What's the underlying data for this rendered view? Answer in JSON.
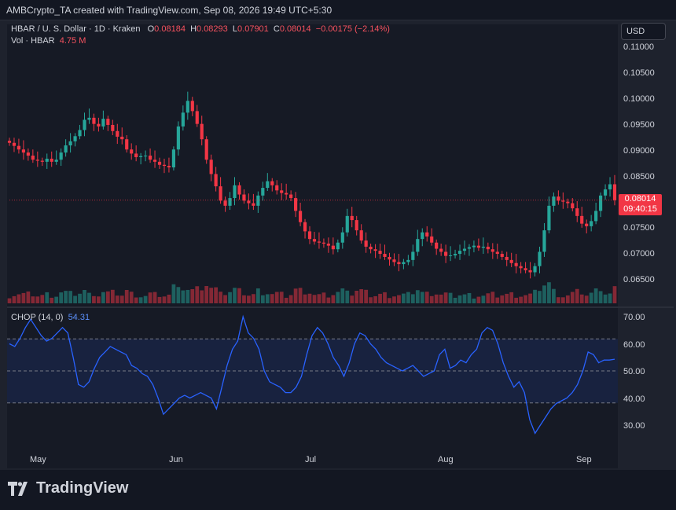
{
  "header": {
    "creator": "AMBCrypto_TA created with TradingView.com, Sep 08, 2026 19:49 UTC+5:30"
  },
  "legend": {
    "symbol": "HBAR / U. S. Dollar · 1D · Kraken",
    "o_label": "O",
    "o": "0.08184",
    "h_label": "H",
    "h": "0.08293",
    "l_label": "L",
    "l": "0.07901",
    "c_label": "C",
    "c": "0.08014",
    "change": "−0.00175 (−2.14%)",
    "vol_label": "Vol · HBAR",
    "vol": "4.75 M"
  },
  "currency_button": "USD",
  "price_axis": [
    "0.11000",
    "0.10500",
    "0.10000",
    "0.09500",
    "0.09000",
    "0.08500",
    "0.07500",
    "0.07000",
    "0.06500"
  ],
  "price_tag": {
    "price": "0.08014",
    "countdown": "09:40:15"
  },
  "chop_legend": {
    "label": "CHOP (14, 0)",
    "value": "54.31"
  },
  "chop_axis": [
    "70.00",
    "60.00",
    "50.00",
    "40.00",
    "30.00"
  ],
  "date_axis": [
    "May",
    "Jun",
    "Jul",
    "Aug",
    "Sep"
  ],
  "footer": {
    "brand": "TradingView"
  },
  "colors": {
    "up": "#26a69a",
    "down": "#f23645",
    "chop": "#2962ff",
    "background": "#131722"
  },
  "chart_data": [
    {
      "type": "candlestick",
      "title": "HBAR / U. S. Dollar · 1D · Kraken",
      "ylim": [
        0.061,
        0.111
      ],
      "x_labels": [
        "May",
        "Jun",
        "Jul",
        "Aug",
        "Sep"
      ],
      "close": [
        0.0913,
        0.0907,
        0.09,
        0.0894,
        0.0888,
        0.088,
        0.0878,
        0.0876,
        0.0882,
        0.0876,
        0.088,
        0.0894,
        0.0908,
        0.0916,
        0.0926,
        0.0938,
        0.0958,
        0.0962,
        0.095,
        0.0945,
        0.096,
        0.0948,
        0.0936,
        0.0925,
        0.092,
        0.09,
        0.0892,
        0.0885,
        0.0887,
        0.0888,
        0.088,
        0.0876,
        0.087,
        0.0868,
        0.0865,
        0.09,
        0.0945,
        0.0972,
        0.0995,
        0.0975,
        0.095,
        0.092,
        0.088,
        0.0852,
        0.0828,
        0.08,
        0.079,
        0.0805,
        0.083,
        0.0812,
        0.08,
        0.0795,
        0.079,
        0.081,
        0.0825,
        0.0838,
        0.083,
        0.082,
        0.0815,
        0.0812,
        0.0805,
        0.078,
        0.0758,
        0.074,
        0.0725,
        0.072,
        0.0718,
        0.0716,
        0.0712,
        0.0705,
        0.0718,
        0.0738,
        0.077,
        0.0762,
        0.0742,
        0.0722,
        0.071,
        0.0705,
        0.0702,
        0.0696,
        0.069,
        0.0685,
        0.068,
        0.0676,
        0.068,
        0.0684,
        0.07,
        0.0725,
        0.0738,
        0.073,
        0.0718,
        0.0706,
        0.07,
        0.0692,
        0.0693,
        0.0696,
        0.0702,
        0.0706,
        0.0709,
        0.0712,
        0.0708,
        0.071,
        0.0705,
        0.07,
        0.0696,
        0.069,
        0.0684,
        0.0678,
        0.0672,
        0.0668,
        0.0664,
        0.066,
        0.0672,
        0.07,
        0.0742,
        0.079,
        0.0808,
        0.08,
        0.0798,
        0.0795,
        0.0785,
        0.077,
        0.0755,
        0.075,
        0.076,
        0.078,
        0.081,
        0.0822,
        0.0832,
        0.0801
      ],
      "volume_peak_labels": [
        "4.75 M"
      ]
    },
    {
      "type": "line",
      "title": "CHOP (14, 0)",
      "ylim": [
        20,
        75
      ],
      "bands": [
        38.2,
        50,
        61.8
      ],
      "values": [
        60,
        59,
        62,
        66,
        69,
        66,
        63,
        61,
        62,
        64,
        66,
        64,
        55,
        45,
        44,
        46,
        51,
        55,
        57,
        59,
        58,
        57,
        56,
        52,
        51,
        49,
        48,
        45,
        40,
        34,
        36,
        38,
        40,
        41,
        40,
        41,
        42,
        41,
        40,
        36,
        44,
        52,
        58,
        61,
        70,
        64,
        62,
        58,
        50,
        46,
        45,
        44,
        42,
        42,
        44,
        48,
        56,
        63,
        66,
        64,
        60,
        55,
        52,
        48,
        53,
        60,
        64,
        63,
        60,
        58,
        55,
        53,
        52,
        51,
        50,
        51,
        52,
        50,
        48,
        49,
        50,
        56,
        58,
        51,
        52,
        54,
        53,
        56,
        58,
        64,
        66,
        65,
        60,
        53,
        48,
        44,
        46,
        42,
        32,
        27,
        30,
        33,
        36,
        38,
        39,
        40,
        42,
        45,
        50,
        57,
        56,
        53,
        54,
        54,
        54.31
      ]
    }
  ]
}
